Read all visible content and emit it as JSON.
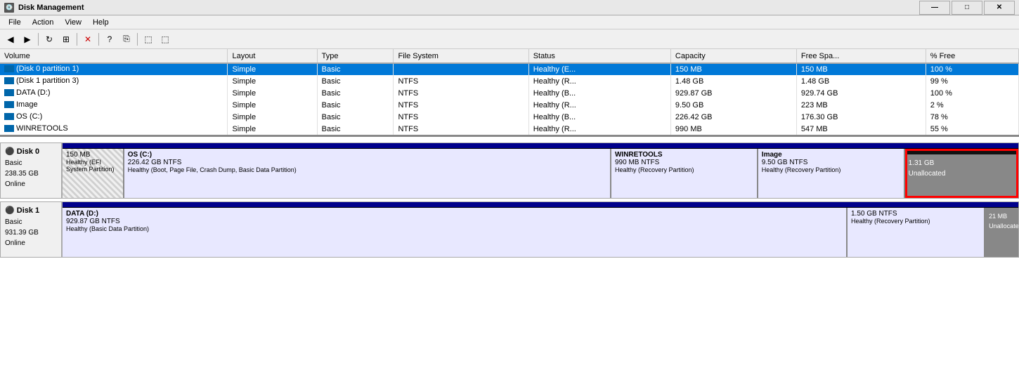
{
  "titlebar": {
    "title": "Disk Management",
    "icon": "💽",
    "minimize": "—",
    "maximize": "□",
    "close": "✕"
  },
  "menubar": {
    "items": [
      "File",
      "Action",
      "View",
      "Help"
    ]
  },
  "table": {
    "columns": [
      "Volume",
      "Layout",
      "Type",
      "File System",
      "Status",
      "Capacity",
      "Free Spa...",
      "% Free"
    ],
    "rows": [
      {
        "volume": "(Disk 0 partition 1)",
        "layout": "Simple",
        "type": "Basic",
        "fs": "",
        "status": "Healthy (E...",
        "capacity": "150 MB",
        "free": "150 MB",
        "pct": "100 %",
        "selected": true
      },
      {
        "volume": "(Disk 1 partition 3)",
        "layout": "Simple",
        "type": "Basic",
        "fs": "NTFS",
        "status": "Healthy (R...",
        "capacity": "1.48 GB",
        "free": "1.48 GB",
        "pct": "99 %",
        "selected": false
      },
      {
        "volume": "DATA (D:)",
        "layout": "Simple",
        "type": "Basic",
        "fs": "NTFS",
        "status": "Healthy (B...",
        "capacity": "929.87 GB",
        "free": "929.74 GB",
        "pct": "100 %",
        "selected": false
      },
      {
        "volume": "Image",
        "layout": "Simple",
        "type": "Basic",
        "fs": "NTFS",
        "status": "Healthy (R...",
        "capacity": "9.50 GB",
        "free": "223 MB",
        "pct": "2 %",
        "selected": false
      },
      {
        "volume": "OS (C:)",
        "layout": "Simple",
        "type": "Basic",
        "fs": "NTFS",
        "status": "Healthy (B...",
        "capacity": "226.42 GB",
        "free": "176.30 GB",
        "pct": "78 %",
        "selected": false
      },
      {
        "volume": "WINRETOOLS",
        "layout": "Simple",
        "type": "Basic",
        "fs": "NTFS",
        "status": "Healthy (R...",
        "capacity": "990 MB",
        "free": "547 MB",
        "pct": "55 %",
        "selected": false
      }
    ]
  },
  "disk0": {
    "name": "Disk 0",
    "type": "Basic",
    "size": "238.35 GB",
    "status": "Online",
    "partitions": [
      {
        "id": "efi",
        "name": "",
        "size": "150 MB",
        "type": "",
        "status": "Healthy (EFI System Partition)",
        "widthPct": 5
      },
      {
        "id": "os",
        "name": "OS (C:)",
        "size": "226.42 GB NTFS",
        "type": "",
        "status": "Healthy (Boot, Page File, Crash Dump, Basic Data Partition)",
        "widthPct": 45
      },
      {
        "id": "winretools",
        "name": "WINRETOOLS",
        "size": "990 MB NTFS",
        "type": "",
        "status": "Healthy (Recovery Partition)",
        "widthPct": 13
      },
      {
        "id": "image",
        "name": "Image",
        "size": "9.50 GB NTFS",
        "type": "",
        "status": "Healthy (Recovery Partition)",
        "widthPct": 13
      },
      {
        "id": "unallocated0",
        "name": "",
        "size": "1.31 GB",
        "type": "Unallocated",
        "status": "",
        "widthPct": 10
      }
    ]
  },
  "disk1": {
    "name": "Disk 1",
    "type": "Basic",
    "size": "931.39 GB",
    "status": "Online",
    "partitions": [
      {
        "id": "data",
        "name": "DATA (D:)",
        "size": "929.87 GB NTFS",
        "type": "",
        "status": "Healthy (Basic Data Partition)",
        "widthPct": 60
      },
      {
        "id": "recovery1",
        "name": "",
        "size": "1.50 GB NTFS",
        "type": "",
        "status": "Healthy (Recovery Partition)",
        "widthPct": 10
      },
      {
        "id": "unallocated1",
        "name": "",
        "size": "21 MB",
        "type": "Unallocated",
        "status": "",
        "widthPct": 2
      }
    ]
  },
  "icons": {
    "back": "◀",
    "forward": "▶",
    "up": "▲",
    "refresh": "↻",
    "properties": "⊞",
    "delete": "✕",
    "help": "?",
    "copy": "⎘",
    "paste": "📋",
    "icon1": "⬚",
    "icon2": "⬚"
  }
}
